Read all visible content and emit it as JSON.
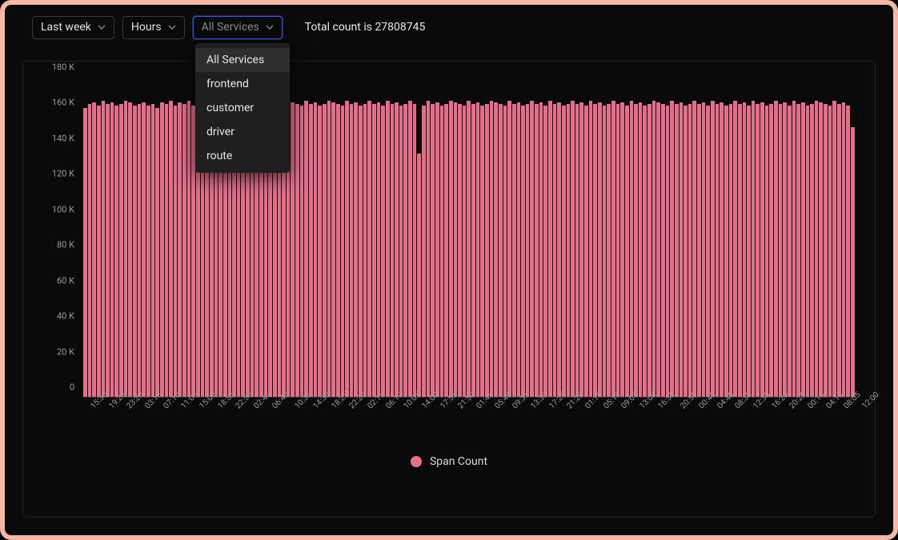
{
  "toolbar": {
    "time_range": "Last week",
    "granularity": "Hours",
    "service": "All Services",
    "total_label": "Total count is",
    "total_value": "27808745"
  },
  "dropdown": {
    "options": [
      "All Services",
      "frontend",
      "customer",
      "driver",
      "route"
    ],
    "selected": "All Services"
  },
  "chart_data": {
    "type": "bar",
    "title": "",
    "xlabel": "",
    "ylabel": "",
    "ylim": [
      0,
      180000
    ],
    "y_ticks": [
      "0",
      "20 K",
      "40 K",
      "60 K",
      "80 K",
      "100 K",
      "120 K",
      "140 K",
      "160 K",
      "180 K"
    ],
    "legend": [
      "Span Count"
    ],
    "categories": [
      "15:30",
      "",
      "",
      "",
      "19:25",
      "",
      "",
      "",
      "23:20",
      "",
      "",
      "",
      "03:15",
      "",
      "",
      "",
      "07:10",
      "",
      "",
      "",
      "11:05",
      "",
      "",
      "",
      "15:00",
      "",
      "",
      "",
      "18:55",
      "",
      "",
      "",
      "22:50",
      "",
      "",
      "",
      "02:45",
      "",
      "",
      "",
      "06:40",
      "",
      "",
      "",
      "10:35",
      "",
      "",
      "",
      "14:30",
      "",
      "",
      "",
      "18:25",
      "",
      "",
      "",
      "22:20",
      "",
      "",
      "",
      "02:15",
      "",
      "",
      "",
      "06:10",
      "",
      "",
      "",
      "10:05",
      "",
      "",
      "",
      "14:00",
      "",
      "",
      "",
      "17:55",
      "",
      "",
      "",
      "21:50",
      "",
      "",
      "",
      "01:45",
      "",
      "",
      "",
      "05:40",
      "",
      "",
      "",
      "09:35",
      "",
      "",
      "",
      "13:30",
      "",
      "",
      "",
      "17:25",
      "",
      "",
      "",
      "21:20",
      "",
      "",
      "",
      "01:15",
      "",
      "",
      "",
      "05:10",
      "",
      "",
      "",
      "09:05",
      "",
      "",
      "",
      "13:00",
      "",
      "",
      "",
      "16:55",
      "",
      "",
      "",
      "20:50",
      "",
      "",
      "",
      "00:45",
      "",
      "",
      "",
      "04:40",
      "",
      "",
      "",
      "08:35",
      "",
      "",
      "",
      "12:30",
      "",
      "",
      "",
      "16:25",
      "",
      "",
      "",
      "20:20",
      "",
      "",
      "",
      "00:15",
      "",
      "",
      "",
      "04:10",
      "",
      "",
      "",
      "08:05",
      "",
      "",
      "",
      "12:00",
      "",
      ""
    ],
    "x_tick_labels": [
      "15:30",
      "19:25",
      "23:20",
      "03:15",
      "07:10",
      "11:05",
      "15:00",
      "18:55",
      "22:50",
      "02:45",
      "06:40",
      "10:35",
      "14:30",
      "18:25",
      "22:20",
      "02:15",
      "06:10",
      "10:05",
      "14:00",
      "17:55",
      "21:50",
      "01:45",
      "05:40",
      "09:35",
      "13:30",
      "17:25",
      "21:20",
      "01:15",
      "05:10",
      "09:05",
      "13:00",
      "16:55",
      "20:50",
      "00:45",
      "04:40",
      "08:35",
      "12:30",
      "16:25",
      "20:20",
      "00:15",
      "04:10",
      "08:05",
      "12:00"
    ],
    "values": [
      163000,
      165000,
      166000,
      164000,
      167000,
      165000,
      166000,
      164000,
      165000,
      167000,
      166000,
      164000,
      165000,
      166000,
      164000,
      165000,
      163000,
      166000,
      165000,
      167000,
      164000,
      166000,
      165000,
      167000,
      164000,
      165000,
      167000,
      165000,
      166000,
      164000,
      165000,
      167000,
      165000,
      166000,
      164000,
      167000,
      165000,
      166000,
      164000,
      165000,
      167000,
      165000,
      166000,
      164000,
      165000,
      167000,
      166000,
      165000,
      164000,
      167000,
      165000,
      166000,
      164000,
      165000,
      167000,
      166000,
      165000,
      164000,
      167000,
      165000,
      166000,
      164000,
      165000,
      167000,
      165000,
      166000,
      164000,
      167000,
      165000,
      166000,
      164000,
      165000,
      167000,
      165000,
      137000,
      164000,
      167000,
      165000,
      166000,
      164000,
      165000,
      167000,
      166000,
      165000,
      164000,
      167000,
      165000,
      166000,
      164000,
      165000,
      167000,
      166000,
      165000,
      164000,
      167000,
      165000,
      166000,
      164000,
      165000,
      167000,
      165000,
      166000,
      164000,
      167000,
      165000,
      166000,
      164000,
      165000,
      167000,
      165000,
      166000,
      164000,
      167000,
      165000,
      166000,
      164000,
      165000,
      167000,
      165000,
      166000,
      164000,
      167000,
      165000,
      166000,
      164000,
      165000,
      167000,
      166000,
      165000,
      164000,
      167000,
      165000,
      166000,
      164000,
      165000,
      167000,
      165000,
      166000,
      164000,
      167000,
      165000,
      166000,
      164000,
      165000,
      167000,
      165000,
      166000,
      164000,
      167000,
      165000,
      166000,
      164000,
      165000,
      167000,
      165000,
      166000,
      164000,
      167000,
      165000,
      166000,
      164000,
      165000,
      167000,
      166000,
      165000,
      164000,
      167000,
      165000,
      166000,
      164000,
      152000
    ]
  },
  "colors": {
    "bar": "#e56e8b",
    "frame": "#f5b8a8",
    "focus": "#3b5bdb"
  }
}
